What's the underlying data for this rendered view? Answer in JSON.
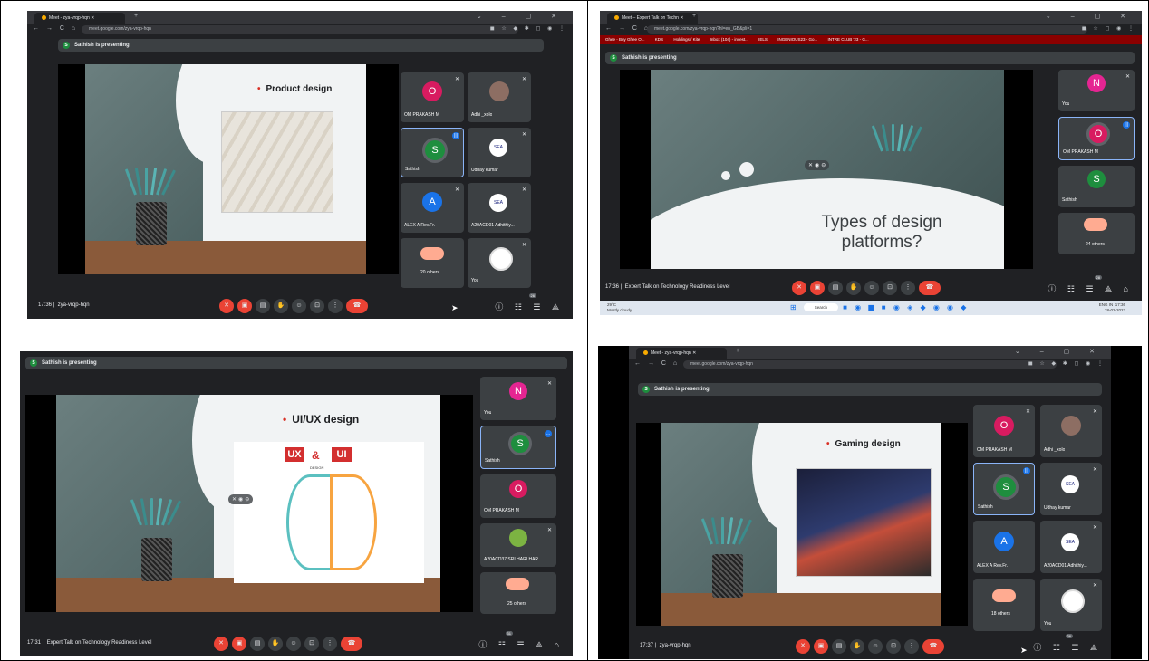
{
  "panels": [
    {
      "id": "top-left",
      "browser": {
        "tab_title": "Meet - zya-vrqp-hqn",
        "url": "meet.google.com/zya-vrqp-hqn"
      },
      "presenting_text": "Sathish is presenting",
      "presenter_initial": "S",
      "slide": {
        "title": "Product design"
      },
      "tiles": [
        {
          "name": "OM PRAKASH M",
          "initial": "O",
          "color": "#d81b60"
        },
        {
          "name": "Adhi _xolo",
          "initial": "",
          "color": "#8d6e63"
        },
        {
          "name": "Sathish",
          "initial": "S",
          "color": "#1e8e3e"
        },
        {
          "name": "Udhay kumar",
          "initial": "SEA",
          "color": "#ffffff"
        },
        {
          "name": "ALEX A Rev.Fr.",
          "initial": "A",
          "color": "#1a73e8"
        },
        {
          "name": "A20ACD01 Adhithiy...",
          "initial": "SEA",
          "color": "#ffffff"
        },
        {
          "name": "20 others",
          "initial": "",
          "color": "#5f6368"
        },
        {
          "name": "You",
          "initial": "",
          "color": "#ffffff"
        }
      ],
      "time": "17:36",
      "meeting_code": "zya-vrqp-hqn",
      "participant_count": "26"
    },
    {
      "id": "top-right",
      "browser": {
        "tab_title": "Meet – Expert Talk on Techn",
        "url": "meet.google.com/zya-vrqp-hqn?hl=en_GB&pli=1",
        "bookmarks": [
          "Ghee - Buy Ghee O...",
          "KDS",
          "Holdings / Kite",
          "Inbox (104) - invest...",
          "IELS",
          "INGENIOUS23 - Go...",
          "INTRE CLUB '23 - G..."
        ]
      },
      "presenting_text": "Sathish is presenting",
      "presenter_initial": "S",
      "slide": {
        "title": "Types of design platforms?"
      },
      "tiles": [
        {
          "name": "You",
          "initial": "N",
          "color": "#e52592"
        },
        {
          "name": "OM PRAKASH M",
          "initial": "O",
          "color": "#d81b60"
        },
        {
          "name": "Sathish",
          "initial": "S",
          "color": "#1e8e3e"
        },
        {
          "name": "24 others",
          "initial": "",
          "color": "#5f6368"
        }
      ],
      "time": "17:36",
      "meeting_title": "Expert Talk on Technology Readiness Level",
      "participant_count": "28",
      "taskbar": {
        "temp": "29°C",
        "weather": "Mostly cloudy",
        "search": "Search",
        "lang": "ENG IN",
        "clock_time": "17:36",
        "clock_date": "28-02-2023"
      }
    },
    {
      "id": "bottom-left",
      "presenting_text": "Sathish is presenting",
      "presenter_initial": "S",
      "slide": {
        "title": "UI/UX design",
        "labels": [
          "UX",
          "&",
          "UI",
          "DESIGN"
        ]
      },
      "tiles": [
        {
          "name": "You",
          "initial": "N",
          "color": "#e52592"
        },
        {
          "name": "Sathish",
          "initial": "S",
          "color": "#1e8e3e"
        },
        {
          "name": "OM PRAKASH M",
          "initial": "O",
          "color": "#d81b60"
        },
        {
          "name": "A20ACD37 SRI HARI HAR...",
          "initial": "",
          "color": "#7cb342"
        },
        {
          "name": "25 others",
          "initial": "",
          "color": "#5f6368"
        }
      ],
      "time": "17:31",
      "meeting_title": "Expert Talk on Technology Readiness Level",
      "participant_count": "31"
    },
    {
      "id": "bottom-right",
      "browser": {
        "tab_title": "Meet - zya-vrqp-hqn",
        "url": "meet.google.com/zya-vrqp-hqn"
      },
      "presenting_text": "Sathish is presenting",
      "presenter_initial": "S",
      "slide": {
        "title": "Gaming design"
      },
      "tiles": [
        {
          "name": "OM PRAKASH M",
          "initial": "O",
          "color": "#d81b60"
        },
        {
          "name": "Adhi _xolo",
          "initial": "",
          "color": "#8d6e63"
        },
        {
          "name": "Sathish",
          "initial": "S",
          "color": "#1e8e3e"
        },
        {
          "name": "Udhay kumar",
          "initial": "SEA",
          "color": "#ffffff"
        },
        {
          "name": "ALEX A Rev.Fr.",
          "initial": "A",
          "color": "#1a73e8"
        },
        {
          "name": "A20ACD01 Adhithiy...",
          "initial": "SEA",
          "color": "#ffffff"
        },
        {
          "name": "18 others",
          "initial": "",
          "color": "#5f6368"
        },
        {
          "name": "You",
          "initial": "",
          "color": "#ffffff"
        }
      ],
      "time": "17:37",
      "meeting_code": "zya-vrqp-hqn",
      "participant_count": "26"
    }
  ],
  "icons": {
    "mic_off": "mic-off-icon",
    "cam_off": "camera-off-icon",
    "captions": "captions-icon",
    "hand": "raise-hand-icon",
    "emoji": "emoji-icon",
    "present": "present-icon",
    "more": "more-vert-icon",
    "hangup": "hangup-icon",
    "info": "info-icon",
    "people": "people-icon",
    "chat": "chat-icon",
    "activities": "activities-icon"
  }
}
